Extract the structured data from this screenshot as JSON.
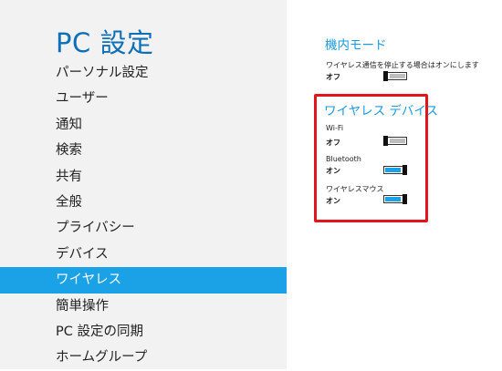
{
  "left": {
    "title": "PC 設定",
    "nav": [
      {
        "label": "パーソナル設定"
      },
      {
        "label": "ユーザー"
      },
      {
        "label": "通知"
      },
      {
        "label": "検索"
      },
      {
        "label": "共有"
      },
      {
        "label": "全般"
      },
      {
        "label": "プライバシー"
      },
      {
        "label": "デバイス"
      },
      {
        "label": "ワイヤレス",
        "selected": true
      },
      {
        "label": "簡単操作"
      },
      {
        "label": "PC 設定の同期"
      },
      {
        "label": "ホームグループ"
      }
    ]
  },
  "airplane": {
    "title": "機内モード",
    "description": "ワイヤレス通信を停止する場合はオンにします",
    "state": "オフ",
    "on": false
  },
  "wireless": {
    "title": "ワイヤレス デバイス",
    "items": [
      {
        "label": "Wi-Fi",
        "state": "オフ",
        "on": false
      },
      {
        "label": "Bluetooth",
        "state": "オン",
        "on": true
      },
      {
        "label": "ワイヤレスマウス",
        "state": "オン",
        "on": true
      }
    ]
  },
  "colors": {
    "accent": "#1aa1e6",
    "title_blue": "#0d6fb8",
    "highlight_red": "#e3151a",
    "left_pane_bg": "#f2f2f2"
  }
}
